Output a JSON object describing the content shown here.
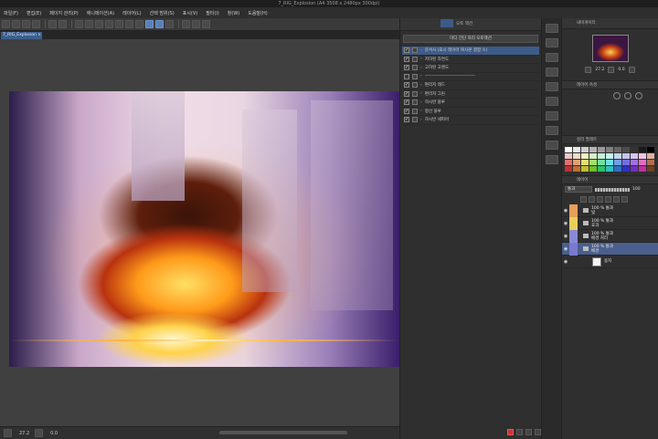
{
  "window": {
    "title": "7_RIG_Explosion (A4 3508 x 2480px 300dpi)"
  },
  "menu": [
    "파일(F)",
    "편집(E)",
    "페이지 관리(P)",
    "애니메이션(A)",
    "레이어(L)",
    "선택 범위(S)",
    "표시(V)",
    "필터(I)",
    "창(W)",
    "도움말(H)"
  ],
  "document_tab": {
    "label": "7_RIG_Explosion ×"
  },
  "status": {
    "zoom": "27.2",
    "rotation": "0.0"
  },
  "sub_view": {
    "header": "오토 액션",
    "selected_set": "미디 간단 처리 오토액션",
    "items": [
      {
        "label": "문서사 (표시 레이어 복사본 결합 ①)",
        "checked": true,
        "selected": true
      },
      {
        "label": "저하된 자연도",
        "checked": true,
        "selected": false
      },
      {
        "label": "고하된 고랜도",
        "checked": true,
        "selected": false
      },
      {
        "label": "----------------------------------",
        "checked": false,
        "selected": false
      },
      {
        "label": "편리지 레드",
        "checked": true,
        "selected": false
      },
      {
        "label": "편리지 그린",
        "checked": true,
        "selected": false
      },
      {
        "label": "하시반 블루",
        "checked": true,
        "selected": false
      },
      {
        "label": "항산 블루",
        "checked": true,
        "selected": false
      },
      {
        "label": "하시반 세피아",
        "checked": true,
        "selected": false
      }
    ]
  },
  "navigator": {
    "header": "내비게이터",
    "zoom": "27.2",
    "rotation": "0.0"
  },
  "properties": {
    "header": "레이어 속성"
  },
  "palette": {
    "header": "컬러 팔레트",
    "colors": [
      "#ffffff",
      "#e8e8e8",
      "#cfcfcf",
      "#b5b5b5",
      "#9a9a9a",
      "#7f7f7f",
      "#666666",
      "#4c4c4c",
      "#333333",
      "#1a1a1a",
      "#000000",
      "#f2c4c4",
      "#f2dcc4",
      "#f2f2c4",
      "#d6f2c4",
      "#c4f2d6",
      "#c4f2f2",
      "#c4d6f2",
      "#c4c4f2",
      "#d6c4f2",
      "#f2c4e6",
      "#e0b0a0",
      "#e07070",
      "#e0a070",
      "#e0e070",
      "#a0e070",
      "#70e0a0",
      "#70e0e0",
      "#70a0e0",
      "#7070e0",
      "#a070e0",
      "#e070c0",
      "#b07050",
      "#c03030",
      "#c07030",
      "#c0c030",
      "#70c030",
      "#30c070",
      "#30c0c0",
      "#3070c0",
      "#3030c0",
      "#7030c0",
      "#c030a0",
      "#704020"
    ]
  },
  "layers": {
    "header": "레이어",
    "blend_mode": "통과",
    "opacity": "100",
    "rows": [
      {
        "line1": "100 % 통과",
        "line2": "빛",
        "color": "#e8a05a",
        "kind": "folder",
        "selected": false
      },
      {
        "line1": "100 % 통과",
        "line2": "효과",
        "color": "#e8d05a",
        "kind": "folder",
        "selected": false
      },
      {
        "line1": "100 % 통과",
        "line2": "배경 처리",
        "color": "#8a8ad8",
        "kind": "folder",
        "selected": false
      },
      {
        "line1": "100 % 통과",
        "line2": "배경",
        "color": "#7a7ad0",
        "kind": "folder",
        "selected": true
      },
      {
        "line1": "",
        "line2": "용지",
        "color": "",
        "kind": "paper",
        "selected": false
      }
    ]
  }
}
